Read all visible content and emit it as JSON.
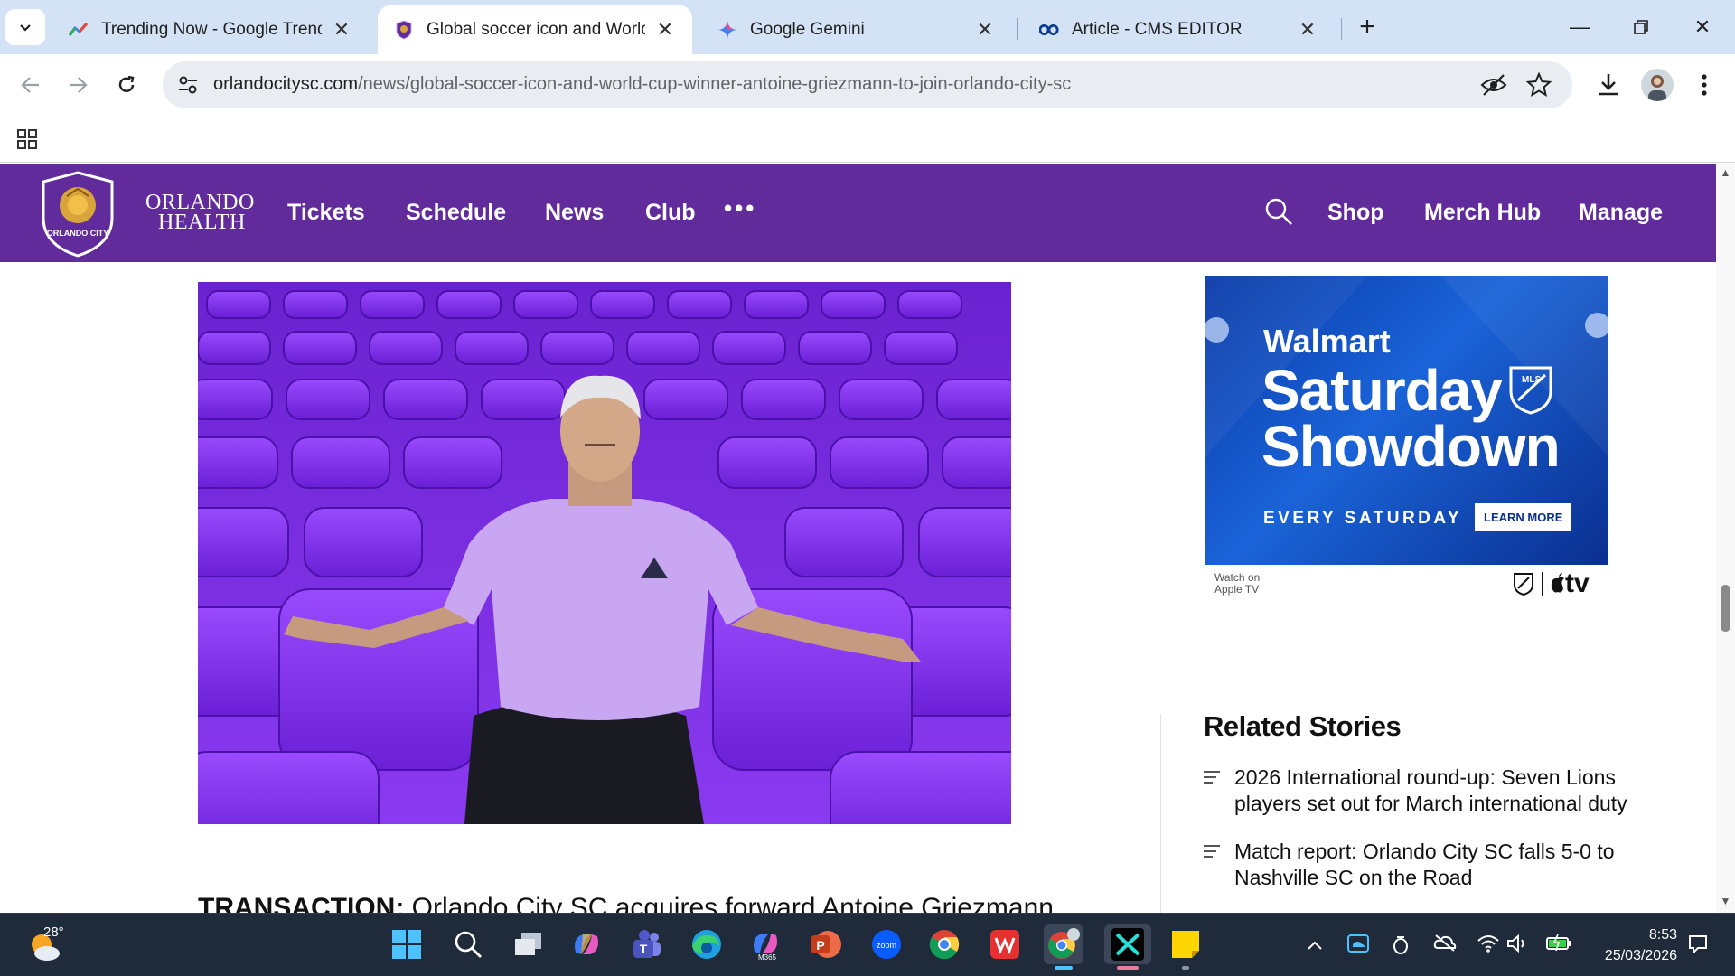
{
  "browser": {
    "tabs": [
      {
        "title": "Trending Now - Google Trends",
        "active": false
      },
      {
        "title": "Global soccer icon and World C",
        "active": true
      },
      {
        "title": "Google Gemini",
        "active": false
      },
      {
        "title": "Article - CMS EDITOR",
        "active": false
      }
    ],
    "url_domain": "orlandocitysc.com",
    "url_path": "/news/global-soccer-icon-and-world-cup-winner-antoine-griezmann-to-join-orlando-city-sc"
  },
  "site": {
    "sponsor_line1": "ORLANDO",
    "sponsor_line2": "HEALTH",
    "crest_text": "ORLANDO CITY",
    "nav_left": [
      "Tickets",
      "Schedule",
      "News",
      "Club"
    ],
    "nav_more": "•••",
    "nav_right": [
      "Shop",
      "Merch Hub",
      "Manage"
    ],
    "brand_color": "#612b9b"
  },
  "ad": {
    "brand": "Walmart",
    "headline_line1": "Saturday",
    "headline_line2": "Showdown",
    "subline": "EVERY SATURDAY",
    "cta": "LEARN MORE",
    "watch_line1": "Watch on",
    "watch_line2": "Apple TV",
    "tv_logo": "tv",
    "league_badge": "MLS"
  },
  "related": {
    "title": "Related Stories",
    "stories": [
      "2026 International round-up: Seven Lions players set out for March international duty",
      "Match report: Orlando City SC falls 5-0 to Nashville SC on the Road"
    ]
  },
  "article": {
    "transaction_label": "TRANSACTION:",
    "transaction_text": "Orlando City SC acquires forward Antoine Griezmann"
  },
  "taskbar": {
    "temperature": "28°",
    "time": "8:53",
    "date": "25/03/2026",
    "m365_label": "M365",
    "zoom_label": "zoom"
  }
}
